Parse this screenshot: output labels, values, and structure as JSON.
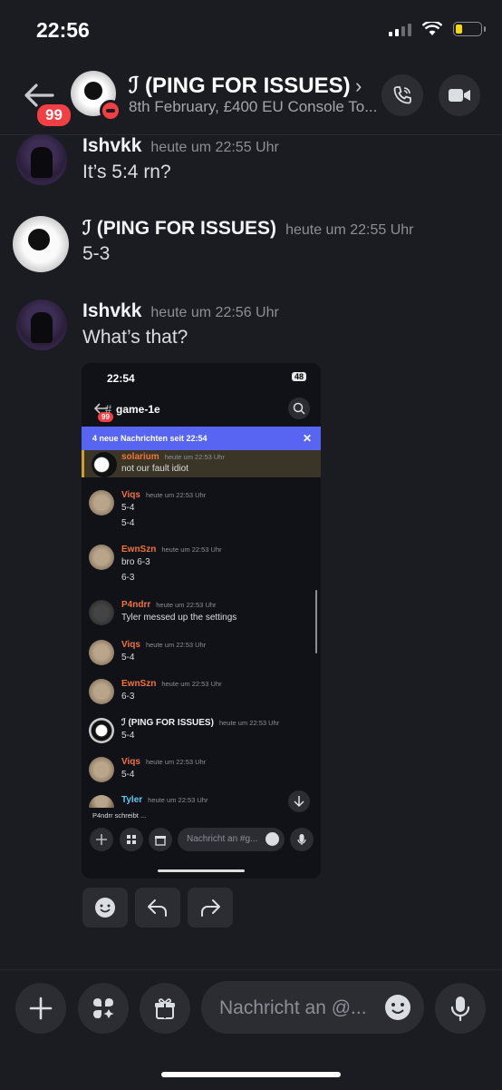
{
  "status_bar": {
    "time": "22:56"
  },
  "header": {
    "badge": "99",
    "title": "ℐ (PING FOR ISSUES)",
    "subtitle": "8th February, £400 EU Console To..."
  },
  "messages": [
    {
      "author": "Ishvkk",
      "time": "heute um 22:55 Uhr",
      "text": "It’s 5:4 rn?"
    },
    {
      "author": "ℐ (PING FOR ISSUES)",
      "time": "heute um 22:55 Uhr",
      "text": "5-3"
    },
    {
      "author": "Ishvkk",
      "time": "heute um 22:56 Uhr",
      "text": "What’s that?"
    }
  ],
  "screenshot": {
    "time": "22:54",
    "battery": "48",
    "badge": "99",
    "channel": "game-1e",
    "banner": "4 neue Nachrichten seit 22:54",
    "messages": [
      {
        "author": "solarium",
        "time": "heute um 22:53 Uhr",
        "lines": [
          "not our fault idiot"
        ]
      },
      {
        "author": "Viqs",
        "time": "heute um 22:53 Uhr",
        "lines": [
          "5-4",
          "5-4"
        ]
      },
      {
        "author": "EwnSzn",
        "time": "heute um 22:53 Uhr",
        "lines": [
          "bro 6-3",
          "6-3"
        ]
      },
      {
        "author": "P4ndrr",
        "time": "heute um 22:53 Uhr",
        "lines": [
          "Tyler messed up the settings"
        ]
      },
      {
        "author": "Viqs",
        "time": "heute um 22:53 Uhr",
        "lines": [
          "5-4"
        ]
      },
      {
        "author": "EwnSzn",
        "time": "heute um 22:53 Uhr",
        "lines": [
          "6-3"
        ]
      },
      {
        "author": "ℐ (PING FOR ISSUES)",
        "time": "heute um 22:53 Uhr",
        "lines": [
          "5-4"
        ]
      },
      {
        "author": "Viqs",
        "time": "heute um 22:53 Uhr",
        "lines": [
          "5-4"
        ]
      },
      {
        "author": "Tyler",
        "time": "heute um 22:53 Uhr",
        "lines": []
      }
    ],
    "typing": "P4ndrr schreibt ...",
    "input_placeholder": "Nachricht an #g..."
  },
  "composer": {
    "placeholder": "Nachricht an @..."
  },
  "colors": {
    "background": "#1b1c22",
    "accent": "#5865f2",
    "danger": "#f23f43",
    "name_orange": "#f0743a"
  }
}
